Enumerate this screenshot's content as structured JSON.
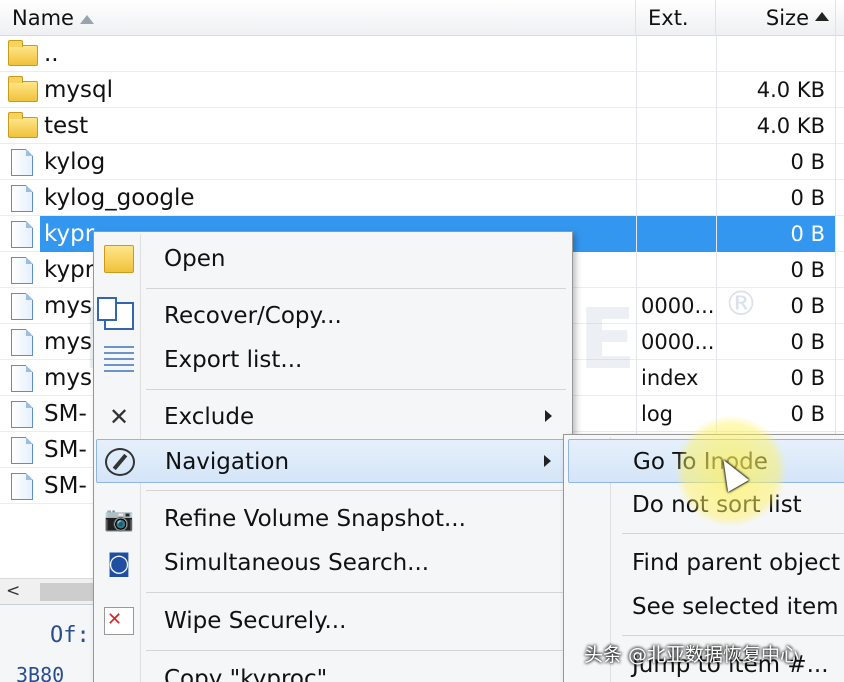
{
  "columns": {
    "name": "Name",
    "ext": "Ext.",
    "size": "Size"
  },
  "rows": [
    {
      "icon": "folder-icon",
      "name": "..",
      "ext": "",
      "size": ""
    },
    {
      "icon": "folder-icon",
      "name": "mysql",
      "ext": "",
      "size": "4.0 KB"
    },
    {
      "icon": "folder-icon",
      "name": "test",
      "ext": "",
      "size": "4.0 KB"
    },
    {
      "icon": "file-icon",
      "name": "kylog",
      "ext": "",
      "size": "0 B"
    },
    {
      "icon": "file-icon",
      "name": "kylog_google",
      "ext": "",
      "size": "0 B"
    },
    {
      "icon": "file-icon",
      "name": "kypr",
      "ext": "",
      "size": "0 B",
      "selected": true
    },
    {
      "icon": "file-icon",
      "name": "kypr",
      "ext": "",
      "size": "0 B"
    },
    {
      "icon": "file-icon",
      "name": "mys",
      "ext": "0000...",
      "size": "0 B"
    },
    {
      "icon": "file-icon",
      "name": "mys",
      "ext": "0000...",
      "size": "0 B"
    },
    {
      "icon": "file-icon",
      "name": "mys",
      "ext": "index",
      "size": "0 B"
    },
    {
      "icon": "file-icon",
      "name": "SM-",
      "ext": "log",
      "size": "0 B"
    },
    {
      "icon": "file-icon",
      "name": "SM-",
      "ext": "",
      "size": ""
    },
    {
      "icon": "file-icon",
      "name": "SM-",
      "ext": "",
      "size": ""
    }
  ],
  "hex": {
    "line1": "Of:",
    "line2": "3B80"
  },
  "watermark": {
    "text": "FROMBYTE",
    "mark": "®"
  },
  "context_menu": {
    "items": [
      {
        "label": "Open",
        "icon": "open-folder-icon"
      },
      {
        "label": "Recover/Copy...",
        "icon": "copy-icon"
      },
      {
        "label": "Export list...",
        "icon": "list-icon"
      },
      {
        "label": "Exclude",
        "icon": "x-icon",
        "submenu": true
      },
      {
        "label": "Navigation",
        "icon": "compass-icon",
        "submenu": true,
        "highlighted": true
      },
      {
        "label": "Refine Volume Snapshot...",
        "icon": "camera-icon"
      },
      {
        "label": "Simultaneous Search...",
        "icon": "binoculars-icon"
      },
      {
        "label": "Wipe Securely...",
        "icon": "wipe-icon"
      },
      {
        "label": "Copy \"kyproc\"",
        "icon": ""
      }
    ]
  },
  "navigation_submenu": {
    "items": [
      {
        "label": "Go To Inode",
        "highlighted": true
      },
      {
        "label": "Do not sort list"
      },
      {
        "label": "Find parent object"
      },
      {
        "label": "See selected item"
      },
      {
        "label": "Jump to item #..."
      }
    ]
  },
  "caption": "头条 @北亚数据恢复中心"
}
